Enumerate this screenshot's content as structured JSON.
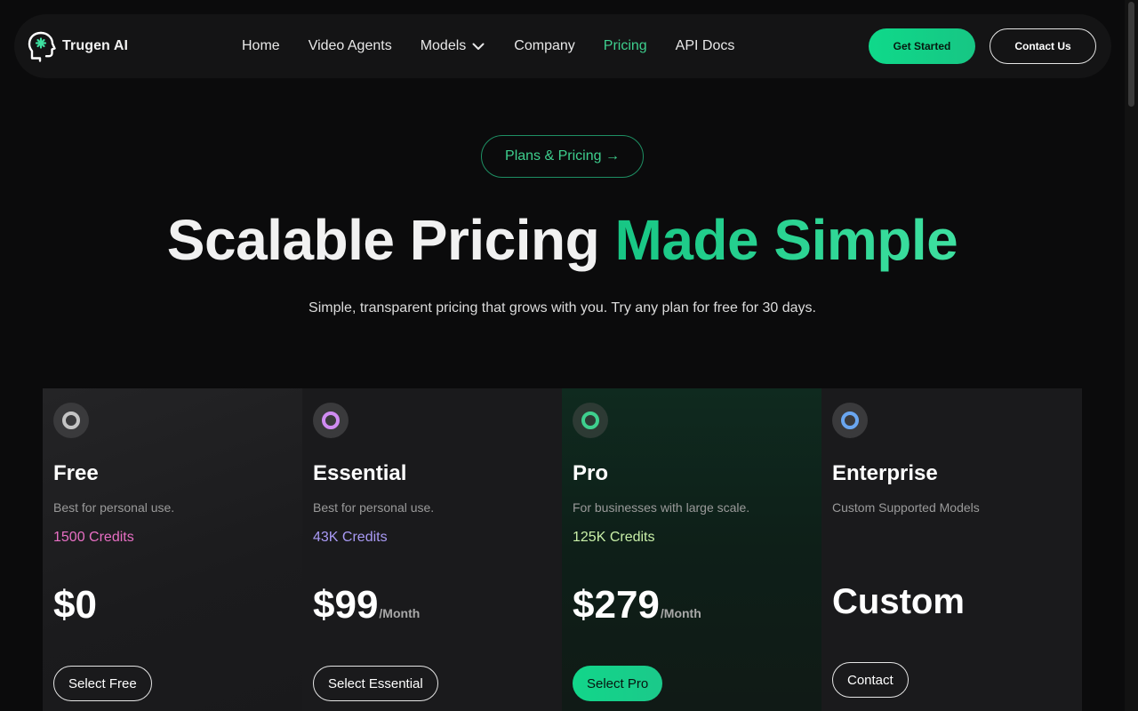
{
  "brand": {
    "name": "Trugen AI"
  },
  "nav": {
    "items": [
      {
        "label": "Home"
      },
      {
        "label": "Video Agents"
      },
      {
        "label": "Models"
      },
      {
        "label": "Company"
      },
      {
        "label": "Pricing"
      },
      {
        "label": "API Docs"
      }
    ],
    "get_started": "Get Started",
    "contact_us": "Contact Us"
  },
  "hero": {
    "pill": "Plans & Pricing →",
    "title_white": "Scalable Pricing ",
    "title_green": "Made Simple",
    "subtitle": "Simple, transparent pricing that grows with you. Try any plan for free for 30 days."
  },
  "plans": [
    {
      "name": "Free",
      "desc": "Best for personal use.",
      "credits": "1500 Credits",
      "price": "$0",
      "period": "",
      "button": "Select Free"
    },
    {
      "name": "Essential",
      "desc": "Best for personal use.",
      "credits": "43K Credits",
      "price": "$99",
      "period": "/Month",
      "button": "Select Essential"
    },
    {
      "name": "Pro",
      "desc": "For businesses with large scale.",
      "credits": "125K Credits",
      "price": "$279",
      "period": "/Month",
      "button": "Select Pro"
    },
    {
      "name": "Enterprise",
      "desc": "Custom Supported Models",
      "credits": "",
      "price": "Custom",
      "period": "",
      "button": "Contact"
    }
  ],
  "colors": {
    "accent": "#3ecf8e",
    "free_credits": "#e86fc4",
    "essential_credits": "#a99af5",
    "pro_credits": "#c9f0a8",
    "free_ring": "#b8b8b8",
    "essential_ring": "#d38cf0",
    "pro_ring": "#3ecf8e",
    "enterprise_ring": "#6aa6f0"
  },
  "icons": {
    "logo": "brain-head-icon",
    "models_dropdown": "chevron-down-icon",
    "plan_badge": "ring-icon"
  }
}
